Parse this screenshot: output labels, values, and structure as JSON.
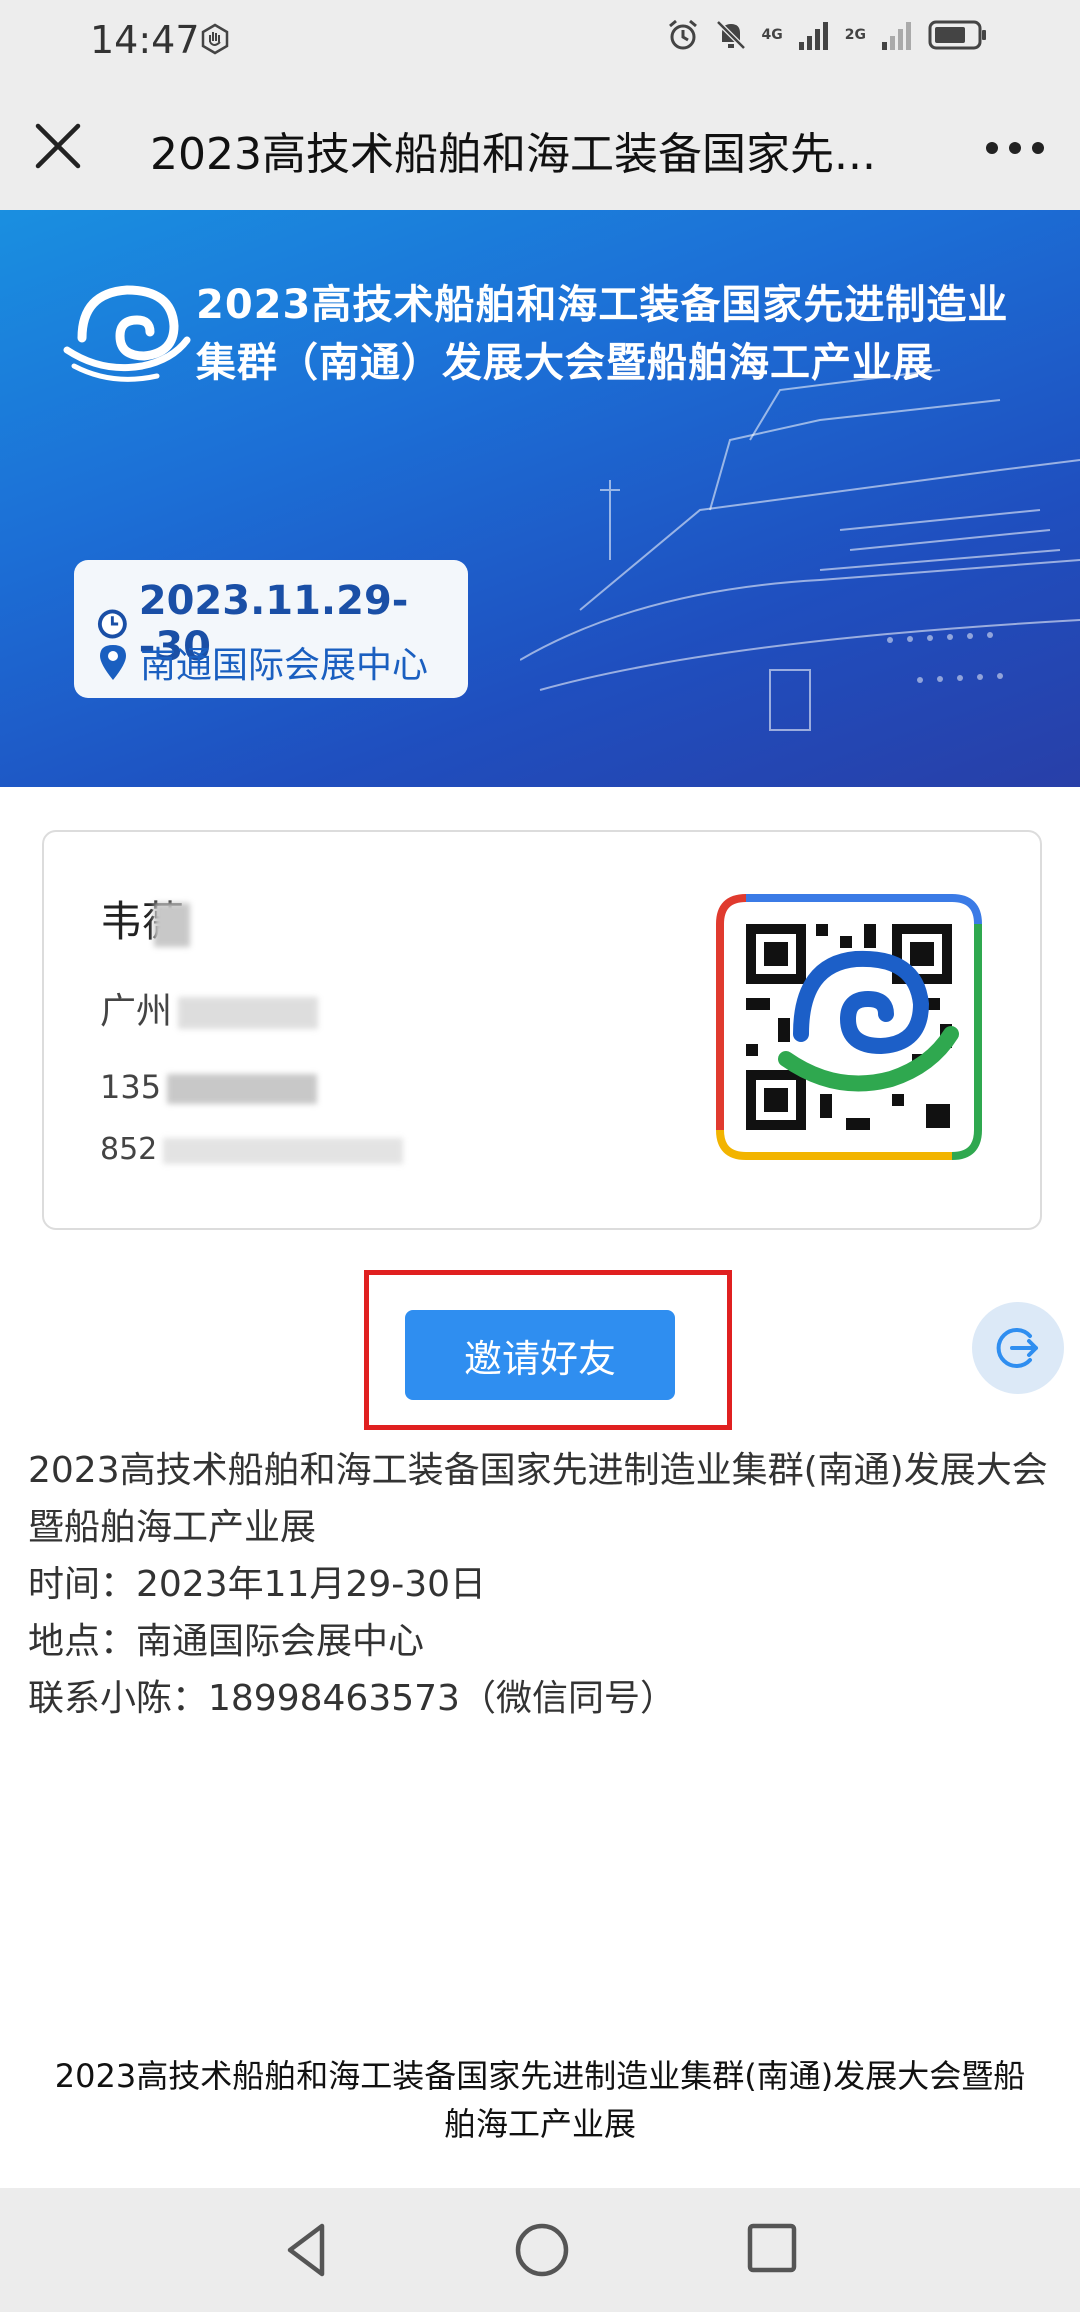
{
  "status_bar": {
    "time": "14:47",
    "network_1": "4G",
    "network_2": "2G"
  },
  "title_bar": {
    "title": "2023高技术船舶和海工装备国家先..."
  },
  "banner": {
    "title_line1": "2023高技术船舶和海工装备国家先进制造业",
    "title_line2": "集群（南通）发展大会暨船舶海工产业展",
    "date": "2023.11.29--30",
    "location": "南通国际会展中心"
  },
  "badge": {
    "name": "韦薇",
    "company": "广州",
    "phone": "135",
    "email": "852"
  },
  "invite_button": {
    "label": "邀请好友"
  },
  "description": {
    "line1": "2023高技术船舶和海工装备国家先进制造业集群(南通)发展大会暨船舶海工产业展",
    "time": "时间：2023年11月29-30日",
    "place": "地点：南通国际会展中心",
    "contact": "联系小陈：18998463573（微信同号）"
  },
  "footer": {
    "text": "2023高技术船舶和海工装备国家先进制造业集群(南通)发展大会暨船舶海工产业展"
  },
  "colors": {
    "accent": "#2f8ef0",
    "highlight": "#e02020",
    "banner_blue": "#1c6fd6"
  },
  "icons": {
    "close": "close-icon",
    "more": "more-icon",
    "clock": "clock-icon",
    "location": "location-pin-icon",
    "float": "share-icon",
    "nav_back": "back-triangle-icon",
    "nav_home": "home-circle-icon",
    "nav_recent": "recent-square-icon"
  }
}
